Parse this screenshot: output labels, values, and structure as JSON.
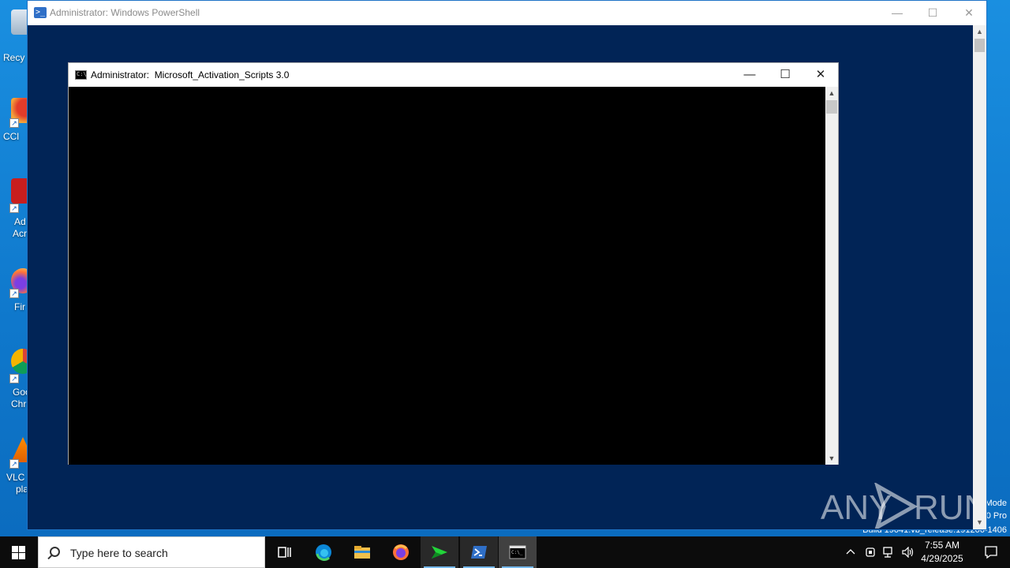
{
  "desktop": {
    "icons": [
      {
        "label_lines": [
          "Recy"
        ]
      },
      {
        "label_lines": [
          "CCl"
        ]
      },
      {
        "label_lines": [
          "Ad",
          "Acr"
        ]
      },
      {
        "label_lines": [
          "Fir"
        ]
      },
      {
        "label_lines": [
          "Goo",
          "Chr"
        ]
      },
      {
        "label_lines": [
          "VLC",
          "pla"
        ]
      }
    ],
    "edition_lines": [
      "Mode",
      "0 Pro",
      "Build 19041.vb_release.191206-1406"
    ],
    "watermark": "ANY RUN"
  },
  "powershell_window": {
    "title": "Administrator: Windows PowerShell",
    "icon": "powershell-icon",
    "background_color": "#012456"
  },
  "cmd_window": {
    "title": "Administrator:  Microsoft_Activation_Scripts 3.0",
    "icon": "cmd-icon",
    "background_color": "#000000"
  },
  "taskbar": {
    "search_placeholder": "Type here to search",
    "pinned": [
      "task-view-icon",
      "edge-icon",
      "file-explorer-icon",
      "firefox-icon",
      "green-arrow-app-icon",
      "powershell-icon",
      "cmd-icon"
    ],
    "active_app": "cmd-icon",
    "clock": {
      "time": "7:55 AM",
      "date": "4/29/2025"
    }
  }
}
